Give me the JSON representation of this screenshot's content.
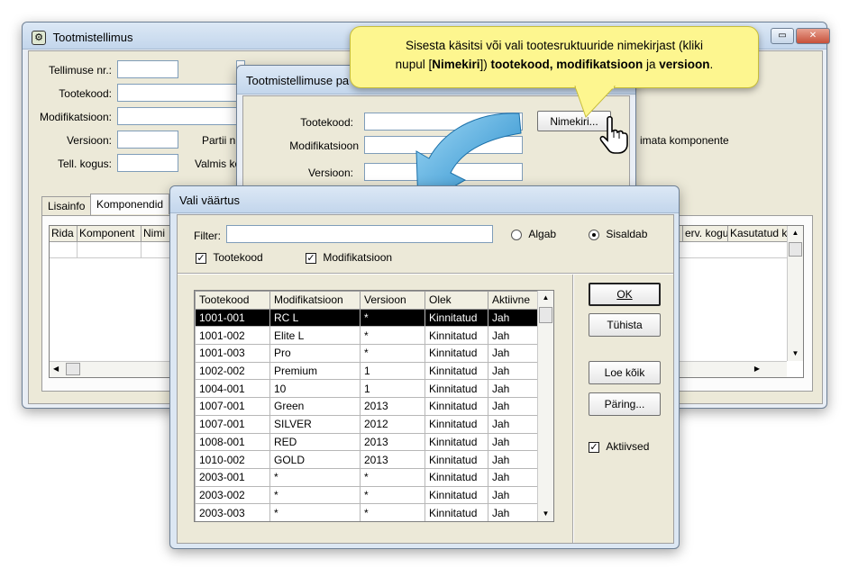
{
  "main_window": {
    "title": "Tootmistellimus",
    "fields": {
      "tellimuse_nr": "Tellimuse nr.:",
      "tootekood": "Tootekood:",
      "modifikatsioon": "Modifikatsioon:",
      "versioon": "Versioon:",
      "tell_kogus": "Tell. kogus:",
      "partii_nr": "Partii nr",
      "valmis_ko": "Valmis ko"
    },
    "side_text": "imata komponente",
    "tabs": [
      "Lisainfo",
      "Komponendid"
    ],
    "grid_headers": [
      "Rida",
      "Komponent",
      "Nimi"
    ],
    "grid_headers_right": [
      "erv. kogu",
      "Kasutatud k"
    ]
  },
  "params_window": {
    "title": "Tootmistellimuse pa",
    "fields": {
      "tootekood": "Tootekood:",
      "modifikatsioon": "Modifikatsioon",
      "versioon": "Versioon:"
    },
    "nimekiri_button": "Nimekiri..."
  },
  "tooltip": {
    "line1": "Sisesta käsitsi või vali tootesruktuuride nimekirjast (kliki",
    "line2_prefix": "nupul [",
    "line2_bold1": "Nimekiri",
    "line2_mid": "]) ",
    "line2_bold2": "tootekood, modifikatsioon",
    "line2_and": " ja ",
    "line2_bold3": "versioon",
    "line2_end": "."
  },
  "dialog": {
    "title": "Vali väärtus",
    "filter_label": "Filter:",
    "filter_value": "",
    "radio_algab": "Algab",
    "radio_sisaldab": "Sisaldab",
    "check_tootekood": "Tootekood",
    "check_modifikatsioon": "Modifikatsioon",
    "buttons": {
      "ok": "OK",
      "tuhista": "Tühista",
      "loe_koik": "Loe kõik",
      "paring": "Päring..."
    },
    "check_aktiivsed": "Aktiivsed",
    "table": {
      "headers": [
        "Tootekood",
        "Modifikatsioon",
        "Versioon",
        "Olek",
        "Aktiivne"
      ],
      "rows": [
        [
          "1001-001",
          "RC L",
          "*",
          "Kinnitatud",
          "Jah"
        ],
        [
          "1001-002",
          "Elite L",
          "*",
          "Kinnitatud",
          "Jah"
        ],
        [
          "1001-003",
          "Pro",
          "*",
          "Kinnitatud",
          "Jah"
        ],
        [
          "1002-002",
          "Premium",
          "1",
          "Kinnitatud",
          "Jah"
        ],
        [
          "1004-001",
          "10",
          "1",
          "Kinnitatud",
          "Jah"
        ],
        [
          "1007-001",
          "Green",
          "2013",
          "Kinnitatud",
          "Jah"
        ],
        [
          "1007-001",
          "SILVER",
          "2012",
          "Kinnitatud",
          "Jah"
        ],
        [
          "1008-001",
          "RED",
          "2013",
          "Kinnitatud",
          "Jah"
        ],
        [
          "1010-002",
          "GOLD",
          "2013",
          "Kinnitatud",
          "Jah"
        ],
        [
          "2003-001",
          "*",
          "*",
          "Kinnitatud",
          "Jah"
        ],
        [
          "2003-002",
          "*",
          "*",
          "Kinnitatud",
          "Jah"
        ],
        [
          "2003-003",
          "*",
          "*",
          "Kinnitatud",
          "Jah"
        ]
      ]
    }
  }
}
